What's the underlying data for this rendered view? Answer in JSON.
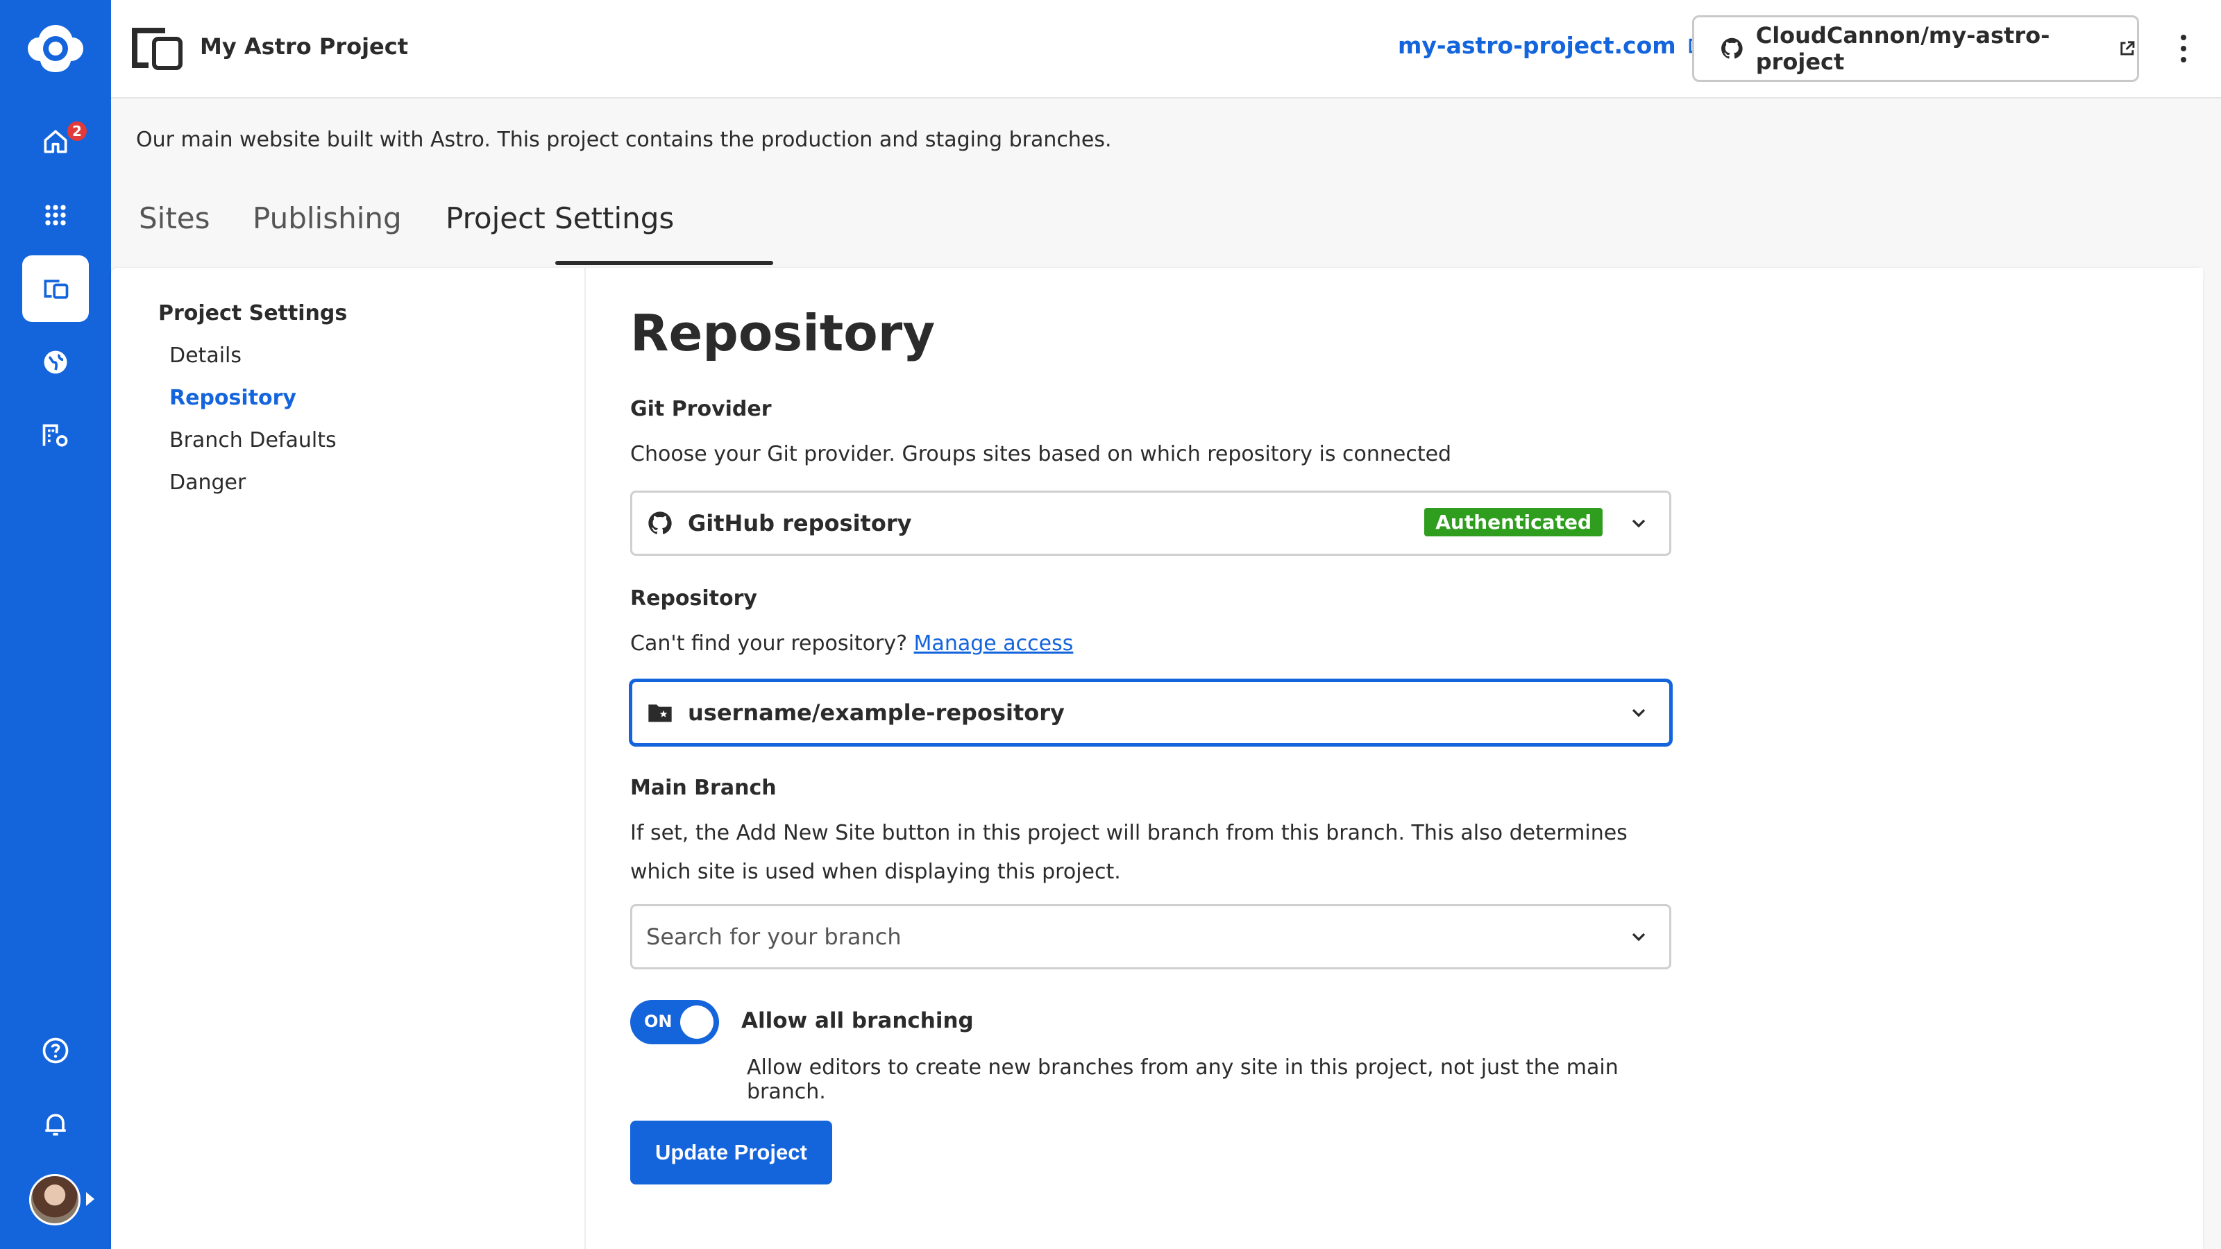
{
  "rail": {
    "notification_count": "2",
    "items": [
      "home-icon",
      "apps-icon",
      "projects-icon",
      "globe-icon",
      "organisation-icon",
      "help-icon",
      "bell-icon"
    ]
  },
  "header": {
    "project_title": "My Astro Project",
    "site_link": "my-astro-project.com",
    "repo_link": "CloudCannon/my-astro-project"
  },
  "description": "Our main website built with Astro. This project contains the production and staging branches.",
  "tabs": [
    {
      "label": "Sites"
    },
    {
      "label": "Publishing"
    },
    {
      "label": "Project Settings",
      "active": true
    }
  ],
  "side_nav": {
    "heading": "Project Settings",
    "items": [
      {
        "label": "Details"
      },
      {
        "label": "Repository",
        "active": true
      },
      {
        "label": "Branch Defaults"
      },
      {
        "label": "Danger"
      }
    ]
  },
  "main": {
    "title": "Repository",
    "git_provider": {
      "label": "Git Provider",
      "help": "Choose your Git provider. Groups sites based on which repository is connected",
      "value": "GitHub repository",
      "badge": "Authenticated"
    },
    "repository": {
      "label": "Repository",
      "help": "Can't find your repository?",
      "help_link": "Manage access",
      "value": "username/example-repository"
    },
    "main_branch": {
      "label": "Main Branch",
      "help": "If set, the Add New Site button in this project will branch from this branch. This also determines which site is used when displaying this project.",
      "placeholder": "Search for your branch"
    },
    "allow_branching": {
      "toggle_state": "ON",
      "label": "Allow all branching",
      "help": "Allow editors to create new branches from any site in this project, not just the main branch."
    },
    "submit_label": "Update Project"
  },
  "colors": {
    "brand": "#1464dc",
    "success": "#2f9e1f",
    "badge_red": "#e23a3a"
  }
}
